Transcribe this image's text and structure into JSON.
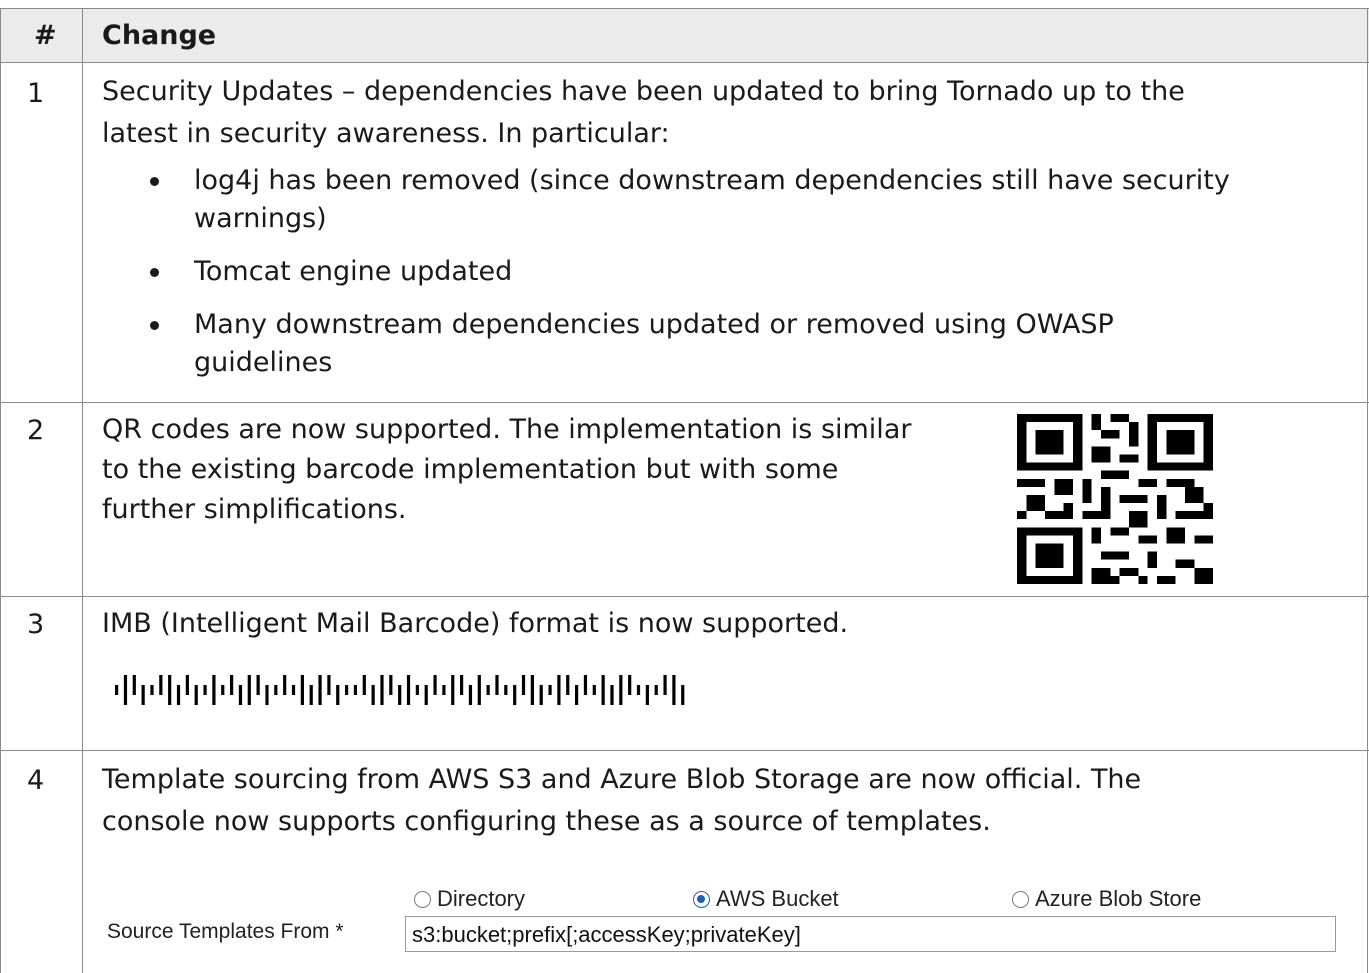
{
  "table": {
    "header": {
      "num": "#",
      "change": "Change"
    },
    "rows": [
      {
        "num": "1",
        "lines": [
          "Security Updates – dependencies have been updated to bring Tornado up to the",
          "latest in security awareness.  In particular:"
        ],
        "bullets": [
          {
            "line1": "log4j has been removed (since downstream dependencies still have security",
            "line2": "warnings)"
          },
          {
            "line1": "Tomcat engine updated",
            "line2": ""
          },
          {
            "line1": "Many downstream dependencies updated or removed using OWASP",
            "line2": "guidelines"
          }
        ]
      },
      {
        "num": "2",
        "lines": [
          "QR codes are now supported.  The implementation is similar",
          "to the existing barcode implementation but with some",
          "further simplifications."
        ],
        "image": "qr-code"
      },
      {
        "num": "3",
        "lines": [
          "IMB (Intelligent Mail Barcode) format is now supported."
        ],
        "image": "intelligent-mail-barcode"
      },
      {
        "num": "4",
        "lines": [
          "Template sourcing from AWS S3 and Azure Blob Storage are now official.  The",
          "console now supports configuring these as a source of templates."
        ],
        "form": {
          "label": "Source Templates From *",
          "options": [
            "Directory",
            "AWS Bucket",
            "Azure Blob Store"
          ],
          "selected": "AWS Bucket",
          "value": "s3:bucket;prefix[;accessKey;privateKey]"
        }
      }
    ]
  },
  "colors": {
    "header_bg": "#ebebeb",
    "grid": "#8a8a8a",
    "radio_selected": "#1e5fb4"
  }
}
